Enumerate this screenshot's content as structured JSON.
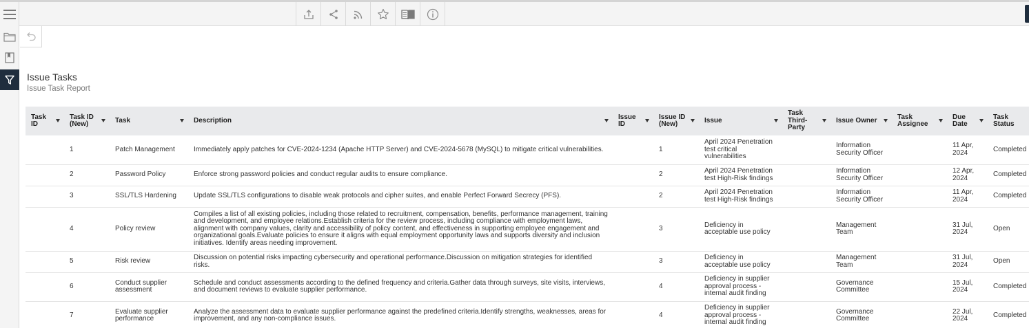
{
  "report": {
    "title": "Issue Tasks",
    "subtitle": "Issue Task Report"
  },
  "toolbar": {
    "icons": [
      "export-icon",
      "share-icon",
      "rss-icon",
      "star-icon",
      "reading-view-icon",
      "info-icon"
    ]
  },
  "sidebar": {
    "icons": [
      "folder-icon",
      "bookmark-icon",
      "filter-icon"
    ]
  },
  "colors": {
    "active_sidebar": "#1f2d3d",
    "header_bg": "#e9eaec"
  },
  "table": {
    "columns": [
      {
        "label": "Task ID"
      },
      {
        "label": "Task ID (New)"
      },
      {
        "label": "Task"
      },
      {
        "label": "Description"
      },
      {
        "label": "Issue ID"
      },
      {
        "label": "Issue ID (New)"
      },
      {
        "label": "Issue"
      },
      {
        "label": "Task Third-Party"
      },
      {
        "label": "Issue Owner"
      },
      {
        "label": "Task Assignee"
      },
      {
        "label": "Due Date"
      },
      {
        "label": "Task Status"
      }
    ],
    "rows": [
      {
        "task_id": "",
        "task_id_new": "1",
        "task": "Patch Management",
        "description": "Immediately apply patches for CVE-2024-1234 (Apache HTTP Server) and CVE-2024-5678 (MySQL) to mitigate critical vulnerabilities.",
        "issue_id": "",
        "issue_id_new": "1",
        "issue": "April 2024 Penetration test critical vulnerabilities",
        "third_party": "",
        "issue_owner": "Information Security Officer",
        "assignee": "",
        "due_date": "11 Apr, 2024",
        "status": "Completed"
      },
      {
        "task_id": "",
        "task_id_new": "2",
        "task": "Password Policy",
        "description": "Enforce strong password policies and conduct regular audits to ensure compliance.",
        "issue_id": "",
        "issue_id_new": "2",
        "issue": "April 2024 Penetration test High-Risk findings",
        "third_party": "",
        "issue_owner": "Information Security Officer",
        "assignee": "",
        "due_date": "12 Apr, 2024",
        "status": "Completed"
      },
      {
        "task_id": "",
        "task_id_new": "3",
        "task": "SSL/TLS Hardening",
        "description": "Update SSL/TLS configurations to disable weak protocols and cipher suites, and enable Perfect Forward Secrecy (PFS).",
        "issue_id": "",
        "issue_id_new": "2",
        "issue": "April 2024 Penetration test High-Risk findings",
        "third_party": "",
        "issue_owner": "Information Security Officer",
        "assignee": "",
        "due_date": "11 Apr, 2024",
        "status": "Completed"
      },
      {
        "task_id": "",
        "task_id_new": "4",
        "task": "Policy review",
        "description": "Compiles a list of all existing policies, including those related to recruitment, compensation, benefits, performance management, training and development, and employee relations.Establish criteria for the review process, including compliance with employment laws, alignment with company values, clarity and accessibility of policy content, and effectiveness in supporting employee engagement and organizational goals.Evaluate policies to ensure it aligns with equal employment opportunity laws and supports diversity and inclusion initiatives. Identify areas needing improvement.",
        "issue_id": "",
        "issue_id_new": "3",
        "issue": "Deficiency in acceptable use policy",
        "third_party": "",
        "issue_owner": "Management Team",
        "assignee": "",
        "due_date": "31 Jul, 2024",
        "status": "Open"
      },
      {
        "task_id": "",
        "task_id_new": "5",
        "task": "Risk review",
        "description": "Discussion on potential risks impacting cybersecurity and operational performance.Discussion on mitigation strategies for identified risks.",
        "issue_id": "",
        "issue_id_new": "3",
        "issue": "Deficiency in acceptable use policy",
        "third_party": "",
        "issue_owner": "Management Team",
        "assignee": "",
        "due_date": "31 Jul, 2024",
        "status": "Open"
      },
      {
        "task_id": "",
        "task_id_new": "6",
        "task": "Conduct supplier assessment",
        "description": "Schedule and conduct assessments according to the defined frequency and criteria.Gather data through surveys, site visits, interviews, and document reviews to evaluate supplier performance.",
        "issue_id": "",
        "issue_id_new": "4",
        "issue": "Deficiency in supplier approval process - internal audit finding",
        "third_party": "",
        "issue_owner": "Governance Committee",
        "assignee": "",
        "due_date": "15 Jul, 2024",
        "status": "Completed"
      },
      {
        "task_id": "",
        "task_id_new": "7",
        "task": "Evaluate supplier performance",
        "description": "Analyze the assessment data to evaluate supplier performance against the predefined criteria.Identify strengths, weaknesses, areas for improvement, and any non-compliance issues.",
        "issue_id": "",
        "issue_id_new": "4",
        "issue": "Deficiency in supplier approval process - internal audit finding",
        "third_party": "",
        "issue_owner": "Governance Committee",
        "assignee": "",
        "due_date": "22 Jul, 2024",
        "status": "Completed"
      }
    ]
  }
}
